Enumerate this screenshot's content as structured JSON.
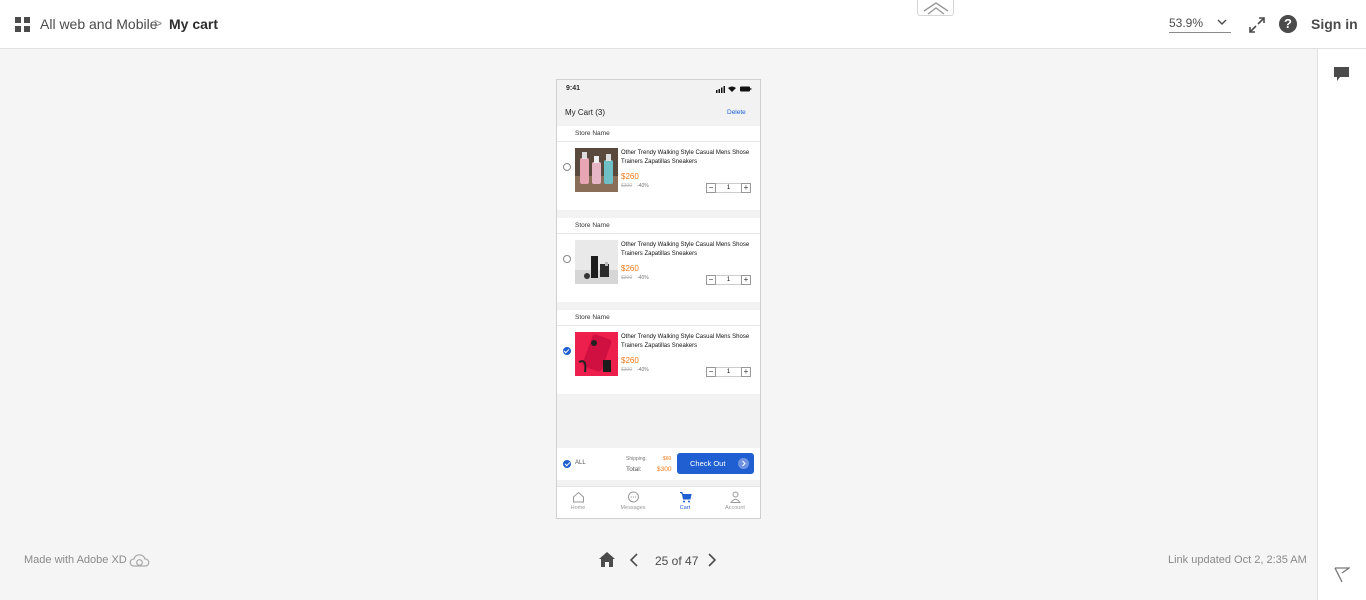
{
  "breadcrumb": {
    "parent": "All web and Mobile",
    "separator": ">",
    "current": "My cart"
  },
  "toolbar": {
    "zoom": "53.9%",
    "sign_in": "Sign in"
  },
  "footer": {
    "made_with": "Made with Adobe XD",
    "page_count": "25 of 47",
    "link_updated": "Link updated Oct 2, 2:35 AM"
  },
  "phone": {
    "status_time": "9:41",
    "cart_title": "My Cart (3)",
    "delete_label": "Delete",
    "items": [
      {
        "store": "Store Name",
        "title": "Other Trendy Walking Style Casual Mens Shose Trainers Zapatillas Sneakers",
        "price": "$260",
        "old_price": "$300",
        "discount": "-40%",
        "qty": "1",
        "checked": false
      },
      {
        "store": "Store Name",
        "title": "Other Trendy Walking Style Casual Mens Shose Trainers Zapatillas Sneakers",
        "price": "$260",
        "old_price": "$300",
        "discount": "-40%",
        "qty": "1",
        "checked": false
      },
      {
        "store": "Store Name",
        "title": "Other Trendy Walking Style Casual Mens Shose Trainers Zapatillas Sneakers",
        "price": "$260",
        "old_price": "$300",
        "discount": "-40%",
        "qty": "1",
        "checked": true
      }
    ],
    "checkout": {
      "all_label": "ALL",
      "shipping_label": "Shipping:",
      "shipping_value": "$60",
      "total_label": "Total:",
      "total_value": "$300",
      "button": "Check Out"
    },
    "tabs": [
      {
        "label": "Home",
        "icon": "home-icon"
      },
      {
        "label": "Messages",
        "icon": "chat-bubble-icon"
      },
      {
        "label": "Cart",
        "icon": "cart-icon",
        "active": true
      },
      {
        "label": "Account",
        "icon": "person-icon"
      }
    ]
  },
  "colors": {
    "accent": "#1f5fd1",
    "price": "#f07a1a",
    "canvas": "#f5f5f5"
  }
}
